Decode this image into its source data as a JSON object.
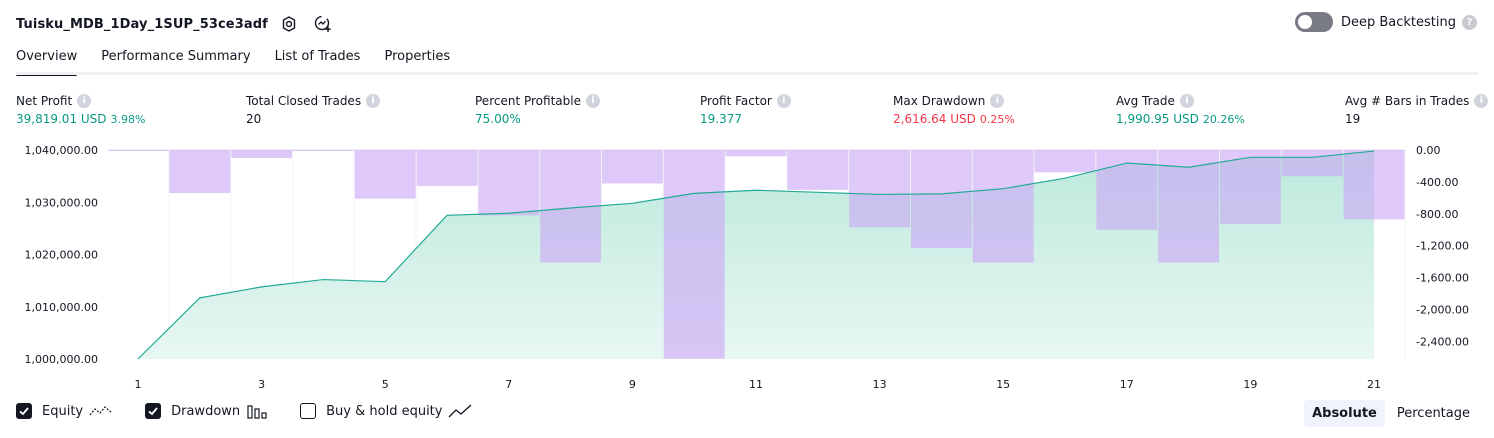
{
  "header": {
    "title": "Tuisku_MDB_1Day_1SUP_53ce3adf",
    "settings_icon": "gear-icon",
    "source_icon": "chart-add-icon",
    "deep_backtesting_label": "Deep Backtesting",
    "deep_backtesting_enabled": false,
    "help_glyph": "?"
  },
  "tabs": [
    {
      "label": "Overview",
      "active": true
    },
    {
      "label": "Performance Summary",
      "active": false
    },
    {
      "label": "List of Trades",
      "active": false
    },
    {
      "label": "Properties",
      "active": false
    }
  ],
  "metrics": {
    "info_glyph": "i",
    "net_profit": {
      "label": "Net Profit",
      "value": "39,819.01 USD",
      "pct": "3.98%"
    },
    "total_closed_trades": {
      "label": "Total Closed Trades",
      "value": "20"
    },
    "percent_profitable": {
      "label": "Percent Profitable",
      "value": "75.00%"
    },
    "profit_factor": {
      "label": "Profit Factor",
      "value": "19.377"
    },
    "max_drawdown": {
      "label": "Max Drawdown",
      "value": "2,616.64 USD",
      "pct": "0.25%"
    },
    "avg_trade": {
      "label": "Avg Trade",
      "value": "1,990.95 USD",
      "pct": "20.26%"
    },
    "avg_bars": {
      "label": "Avg # Bars in Trades",
      "value": "19"
    }
  },
  "colors": {
    "positive": "#089981",
    "negative": "#f23645",
    "equity_line": "#22ab94",
    "equity_fill_top": "#bce9dc",
    "equity_fill_bottom": "#e8f7f3",
    "drawdown_bar": "#cba6f7"
  },
  "chart_data": {
    "type": "area",
    "x": [
      1,
      2,
      3,
      4,
      5,
      6,
      7,
      8,
      9,
      10,
      11,
      12,
      13,
      14,
      15,
      16,
      17,
      18,
      19,
      20,
      21
    ],
    "x_tick_labels": [
      "1",
      "3",
      "5",
      "7",
      "9",
      "11",
      "13",
      "15",
      "17",
      "19",
      "21"
    ],
    "y_left_ticks": [
      "1,040,000.00",
      "1,030,000.00",
      "1,020,000.00",
      "1,010,000.00",
      "1,000,000.00"
    ],
    "y_right_ticks": [
      "0.00",
      "-400.00",
      "-800.00",
      "-1,200.00",
      "-1,600.00",
      "-2,000.00",
      "-2,400.00"
    ],
    "y_left_range": [
      1000000,
      1040000
    ],
    "y_right_range": [
      -2620,
      0
    ],
    "series": [
      {
        "name": "Equity",
        "type": "area",
        "axis": "left",
        "values": [
          1000000,
          1011700,
          1013800,
          1015200,
          1014800,
          1027500,
          1027900,
          1028900,
          1029800,
          1031700,
          1032300,
          1031900,
          1031500,
          1031600,
          1032600,
          1034600,
          1037500,
          1036700,
          1038600,
          1038600,
          1039800
        ]
      },
      {
        "name": "Drawdown",
        "type": "bar",
        "axis": "right",
        "values": [
          -5,
          -540,
          -100,
          -5,
          -610,
          -450,
          -820,
          -1410,
          -420,
          -2617,
          -80,
          -500,
          -970,
          -1230,
          -1410,
          -280,
          -1000,
          -1410,
          -930,
          -330,
          -870
        ]
      }
    ],
    "legend": [
      {
        "name": "Equity",
        "checked": true,
        "icon": "equity-line-icon"
      },
      {
        "name": "Drawdown",
        "checked": true,
        "icon": "drawdown-bars-icon"
      },
      {
        "name": "Buy & hold equity",
        "checked": false,
        "icon": "buy-hold-line-icon"
      }
    ],
    "grid": true
  },
  "view_mode": {
    "options": [
      "Absolute",
      "Percentage"
    ],
    "selected": "Absolute"
  }
}
